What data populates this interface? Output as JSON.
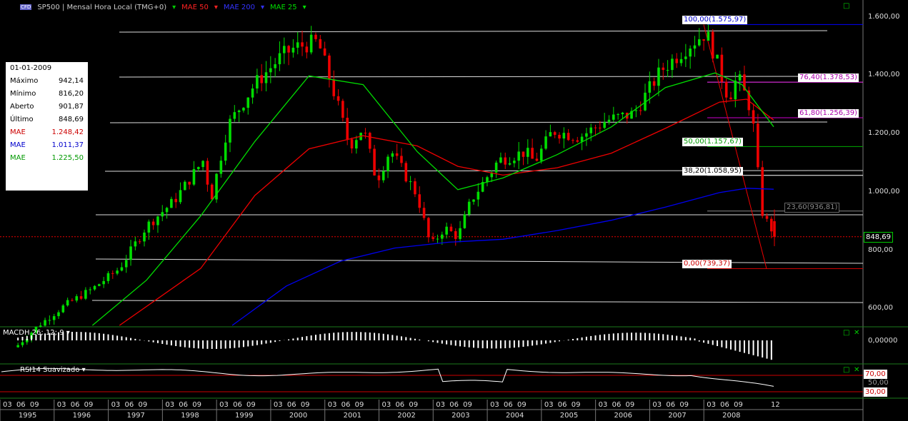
{
  "header": {
    "symbol": "SP500",
    "title": "SP500 | Mensal Hora Local (TMG+0)",
    "mae50": "MAE 50",
    "mae200": "MAE 200",
    "mae25": "MAE 25"
  },
  "infobox": {
    "date": "01-01-2009",
    "rows": [
      {
        "label": "Máximo",
        "value": "942,14",
        "color": "#000000"
      },
      {
        "label": "Mínimo",
        "value": "816,20",
        "color": "#000000"
      },
      {
        "label": "Aberto",
        "value": "901,87",
        "color": "#000000"
      },
      {
        "label": "Último",
        "value": "848,69",
        "color": "#000000"
      },
      {
        "label": "MAE",
        "value": "1.248,42",
        "color": "#cc0000"
      },
      {
        "label": "MAE",
        "value": "1.011,37",
        "color": "#0000cc"
      },
      {
        "label": "MAE",
        "value": "1.225,50",
        "color": "#009900"
      }
    ]
  },
  "fib_labels": [
    {
      "text": "100,00(1.575,97)",
      "color": "#0000cc"
    },
    {
      "text": "76,40(1.378,53)",
      "color": "#aa00aa"
    },
    {
      "text": "61,80(1.256,39)",
      "color": "#aa00aa"
    },
    {
      "text": "50,00(1.157,67)",
      "color": "#009900"
    },
    {
      "text": "38,20(1.058,95)",
      "color": "#000000"
    },
    {
      "text": "23,60(936,81)",
      "color": "#888888"
    },
    {
      "text": "0,00(739,37)",
      "color": "#cc0000"
    }
  ],
  "price_axis": [
    "1.600,00",
    "1.400,00",
    "1.200,00",
    "1.000,00",
    "800,00",
    "600,00"
  ],
  "last_price": "848,69",
  "macd_panel": {
    "title": "MACDH 26; 12; 9",
    "axis": "0,00000"
  },
  "rsi_panel": {
    "title": "RSI14 Suavizado",
    "axis_mid": "50,00",
    "level_high": "70,00",
    "level_low": "30,00"
  },
  "x_axis": {
    "quarters": [
      "03",
      "06",
      "09"
    ],
    "years": [
      "1995",
      "1996",
      "1997",
      "1998",
      "1999",
      "2000",
      "2001",
      "2002",
      "2003",
      "2004",
      "2005",
      "2006",
      "2007",
      "2008"
    ],
    "last_tick": "12"
  },
  "colors": {
    "up": "#00dd00",
    "down": "#ee0000",
    "mae50": "#ee0000",
    "mae200": "#0000ee",
    "mae25": "#00dd00",
    "trend": "#ffffff"
  },
  "chart_data": {
    "type": "candlestick",
    "title": "SP500 | Mensal Hora Local (TMG+0)",
    "interval": "monthly",
    "x_range": [
      "1995-01",
      "2009-01"
    ],
    "ylim": [
      540,
      1660
    ],
    "y_ticks": [
      600,
      800,
      1000,
      1200,
      1400,
      1600
    ],
    "price_points": [
      {
        "date": "1995-01",
        "close": 470
      },
      {
        "date": "1995-06",
        "close": 544
      },
      {
        "date": "1995-12",
        "close": 615
      },
      {
        "date": "1996-06",
        "close": 670
      },
      {
        "date": "1996-12",
        "close": 740
      },
      {
        "date": "1997-06",
        "close": 885
      },
      {
        "date": "1997-12",
        "close": 970
      },
      {
        "date": "1998-07",
        "close": 1120
      },
      {
        "date": "1998-08",
        "close": 957
      },
      {
        "date": "1998-12",
        "close": 1229
      },
      {
        "date": "1999-06",
        "close": 1372
      },
      {
        "date": "1999-12",
        "close": 1469
      },
      {
        "date": "2000-03",
        "close": 1498
      },
      {
        "date": "2000-08",
        "close": 1517
      },
      {
        "date": "2000-12",
        "close": 1320
      },
      {
        "date": "2001-03",
        "close": 1160
      },
      {
        "date": "2001-06",
        "close": 1224
      },
      {
        "date": "2001-09",
        "close": 1040
      },
      {
        "date": "2001-12",
        "close": 1148
      },
      {
        "date": "2002-06",
        "close": 990
      },
      {
        "date": "2002-09",
        "close": 815
      },
      {
        "date": "2002-12",
        "close": 880
      },
      {
        "date": "2003-03",
        "close": 848
      },
      {
        "date": "2003-06",
        "close": 975
      },
      {
        "date": "2003-12",
        "close": 1111
      },
      {
        "date": "2004-06",
        "close": 1140
      },
      {
        "date": "2004-08",
        "close": 1104
      },
      {
        "date": "2004-12",
        "close": 1212
      },
      {
        "date": "2005-06",
        "close": 1191
      },
      {
        "date": "2005-12",
        "close": 1248
      },
      {
        "date": "2006-06",
        "close": 1270
      },
      {
        "date": "2006-12",
        "close": 1418
      },
      {
        "date": "2007-06",
        "close": 1503
      },
      {
        "date": "2007-10",
        "close": 1549
      },
      {
        "date": "2007-12",
        "close": 1468
      },
      {
        "date": "2008-03",
        "close": 1322
      },
      {
        "date": "2008-05",
        "close": 1400
      },
      {
        "date": "2008-08",
        "close": 1282
      },
      {
        "date": "2008-09",
        "close": 1166
      },
      {
        "date": "2008-10",
        "close": 968
      },
      {
        "date": "2008-11",
        "close": 896
      },
      {
        "date": "2008-12",
        "close": 903
      },
      {
        "date": "2009-01",
        "open": 901.87,
        "high": 942.14,
        "low": 816.2,
        "close": 848.69
      }
    ],
    "mae25": [
      {
        "date": "1996-06",
        "value": 545
      },
      {
        "date": "1997-06",
        "value": 700
      },
      {
        "date": "1998-06",
        "value": 920
      },
      {
        "date": "1999-06",
        "value": 1175
      },
      {
        "date": "2000-06",
        "value": 1400
      },
      {
        "date": "2001-06",
        "value": 1370
      },
      {
        "date": "2002-06",
        "value": 1140
      },
      {
        "date": "2003-03",
        "value": 1010
      },
      {
        "date": "2004-01",
        "value": 1050
      },
      {
        "date": "2005-01",
        "value": 1130
      },
      {
        "date": "2006-01",
        "value": 1225
      },
      {
        "date": "2007-01",
        "value": 1360
      },
      {
        "date": "2007-12",
        "value": 1410
      },
      {
        "date": "2008-06",
        "value": 1370
      },
      {
        "date": "2009-01",
        "value": 1225.5
      }
    ],
    "mae50": [
      {
        "date": "1996-12",
        "value": 545
      },
      {
        "date": "1998-06",
        "value": 740
      },
      {
        "date": "1999-06",
        "value": 990
      },
      {
        "date": "2000-06",
        "value": 1150
      },
      {
        "date": "2001-06",
        "value": 1195
      },
      {
        "date": "2002-06",
        "value": 1160
      },
      {
        "date": "2003-03",
        "value": 1090
      },
      {
        "date": "2004-01",
        "value": 1060
      },
      {
        "date": "2005-01",
        "value": 1085
      },
      {
        "date": "2006-01",
        "value": 1135
      },
      {
        "date": "2007-01",
        "value": 1220
      },
      {
        "date": "2008-01",
        "value": 1310
      },
      {
        "date": "2008-07",
        "value": 1320
      },
      {
        "date": "2009-01",
        "value": 1248.42
      }
    ],
    "mae200": [
      {
        "date": "1999-01",
        "value": 545
      },
      {
        "date": "2000-01",
        "value": 680
      },
      {
        "date": "2001-01",
        "value": 765
      },
      {
        "date": "2002-01",
        "value": 810
      },
      {
        "date": "2003-01",
        "value": 830
      },
      {
        "date": "2004-01",
        "value": 840
      },
      {
        "date": "2005-01",
        "value": 870
      },
      {
        "date": "2006-01",
        "value": 905
      },
      {
        "date": "2007-01",
        "value": 950
      },
      {
        "date": "2008-01",
        "value": 1000
      },
      {
        "date": "2008-07",
        "value": 1015
      },
      {
        "date": "2009-01",
        "value": 1011.37
      }
    ],
    "fibonacci": [
      {
        "level": 100.0,
        "price": 1575.97
      },
      {
        "level": 76.4,
        "price": 1378.53
      },
      {
        "level": 61.8,
        "price": 1256.39
      },
      {
        "level": 50.0,
        "price": 1157.67
      },
      {
        "level": 38.2,
        "price": 1058.95
      },
      {
        "level": 23.6,
        "price": 936.81
      },
      {
        "level": 0.0,
        "price": 739.37
      }
    ],
    "horizontal_lines": [
      1570,
      1395,
      1250,
      1080,
      940,
      785,
      640
    ],
    "legend": [
      "MAE 50",
      "MAE 200",
      "MAE 25"
    ],
    "legend_position": "top-left"
  }
}
